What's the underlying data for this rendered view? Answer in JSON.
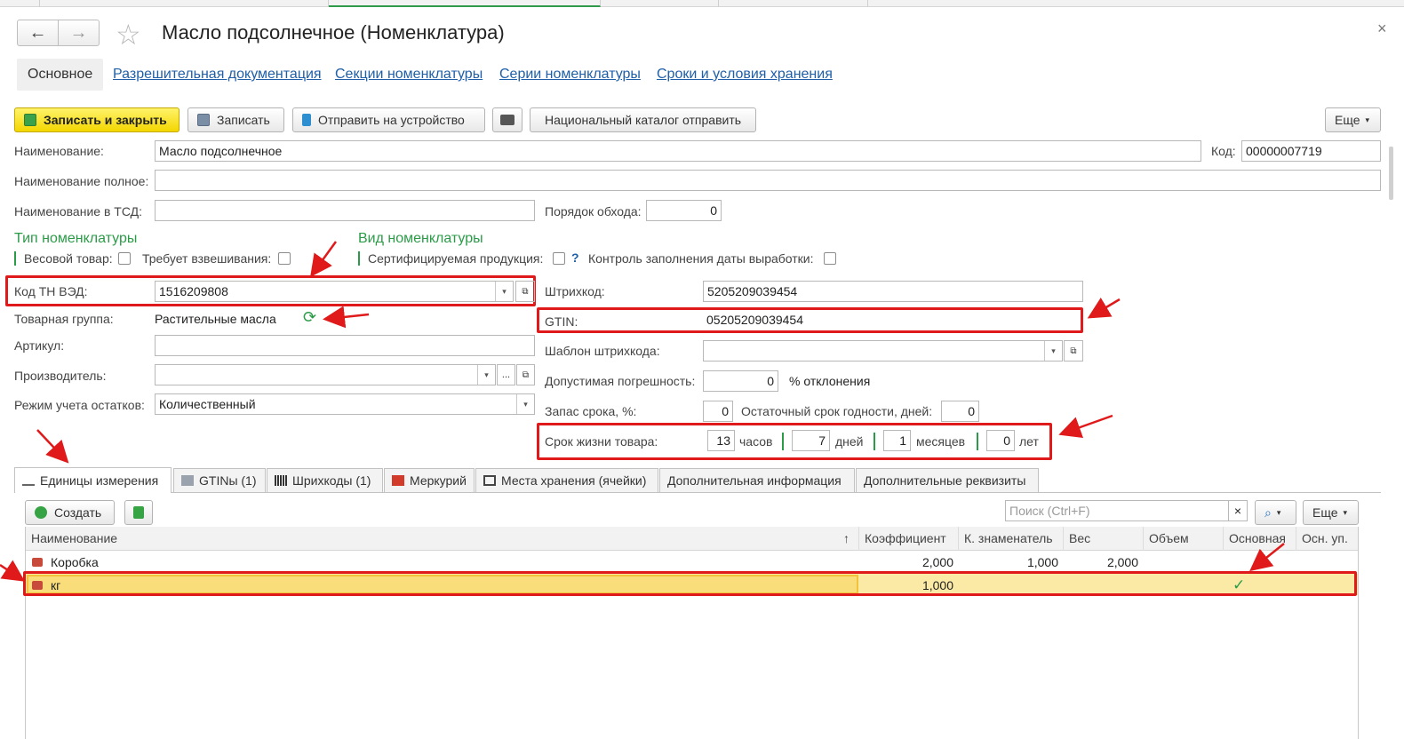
{
  "window": {
    "title": "Масло подсолнечное (Номенклатура)",
    "back_icon": "←",
    "forward_icon": "→",
    "star_icon": "☆",
    "close_icon": "×"
  },
  "form_tabs": [
    {
      "label": "Основное",
      "active": true
    },
    {
      "label": "Разрешительная документация"
    },
    {
      "label": "Секции номенклатуры"
    },
    {
      "label": "Серии номенклатуры"
    },
    {
      "label": "Сроки и условия хранения"
    }
  ],
  "toolbar": {
    "save_close": "Записать и закрыть",
    "save": "Записать",
    "send_device": "Отправить на устройство",
    "national_catalog": "Национальный каталог отправить",
    "more": "Еще",
    "dropdown": "▾"
  },
  "fields": {
    "name_label": "Наименование:",
    "name_value": "Масло подсолнечное",
    "code_label": "Код:",
    "code_value": "00000007719",
    "fullname_label": "Наименование полное:",
    "fullname_value": "",
    "tsd_label": "Наименование в ТСД:",
    "tsd_value": "",
    "order_label": "Порядок обхода:",
    "order_value": "0",
    "type_section": "Тип номенклатуры",
    "kind_section": "Вид номенклатуры",
    "weight_label": "Весовой товар:",
    "weigh_required_label": "Требует взвешивания:",
    "certified_label": "Сертифицируемая продукция:",
    "help_mark": "?",
    "date_control_label": "Контроль заполнения даты выработки:",
    "tnved_label": "Код ТН ВЭД:",
    "tnved_value": "1516209808",
    "group_label": "Товарная группа:",
    "group_value": "Растительные масла",
    "article_label": "Артикул:",
    "article_value": "",
    "manufacturer_label": "Производитель:",
    "manufacturer_value": "",
    "stock_mode_label": "Режим учета остатков:",
    "stock_mode_value": "Количественный",
    "barcode_label": "Штрихкод:",
    "barcode_value": "5205209039454",
    "gtin_label": "GTIN:",
    "gtin_value": "05205209039454",
    "barcode_template_label": "Шаблон штрихкода:",
    "barcode_template_value": "",
    "tolerance_label": "Допустимая погрешность:",
    "tolerance_value": "0",
    "tolerance_unit": "% отклонения",
    "reserve_label": "Запас срока, %:",
    "reserve_value": "0",
    "residual_label": "Остаточный срок годности, дней:",
    "residual_value": "0",
    "life_label": "Срок жизни товара:",
    "life_hours": "13",
    "hours_unit": "часов",
    "life_days": "7",
    "days_unit": "дней",
    "life_months": "1",
    "months_unit": "месяцев",
    "life_years": "0",
    "years_unit": "лет",
    "ellipsis": "..."
  },
  "bottom_tabs": [
    {
      "label": "Единицы измерения",
      "active": true
    },
    {
      "label": "GTINы (1)"
    },
    {
      "label": "Шрихкоды (1)"
    },
    {
      "label": "Меркурий"
    },
    {
      "label": "Места хранения (ячейки)"
    },
    {
      "label": "Дополнительная информация"
    },
    {
      "label": "Дополнительные реквизиты"
    }
  ],
  "units_toolbar": {
    "create": "Создать",
    "search_placeholder": "Поиск (Ctrl+F)",
    "clear": "×",
    "more": "Еще"
  },
  "table": {
    "columns": [
      "Наименование",
      "Коэффициент",
      "К. знаменатель",
      "Вес",
      "Объем",
      "Основная",
      "Осн. уп."
    ],
    "sort_mark": "↑",
    "rows": [
      {
        "name": "Коробка",
        "coef": "2,000",
        "denom": "1,000",
        "weight": "2,000",
        "volume": "",
        "main": "",
        "pack": ""
      },
      {
        "name": "кг",
        "coef": "1,000",
        "denom": "",
        "weight": "",
        "volume": "",
        "main": "✓",
        "pack": ""
      }
    ]
  },
  "colors": {
    "accent_green": "#2b9b48",
    "link_blue": "#1f5fa8",
    "highlight_red": "#e01a1a",
    "selected_row": "#fbeaa5"
  }
}
